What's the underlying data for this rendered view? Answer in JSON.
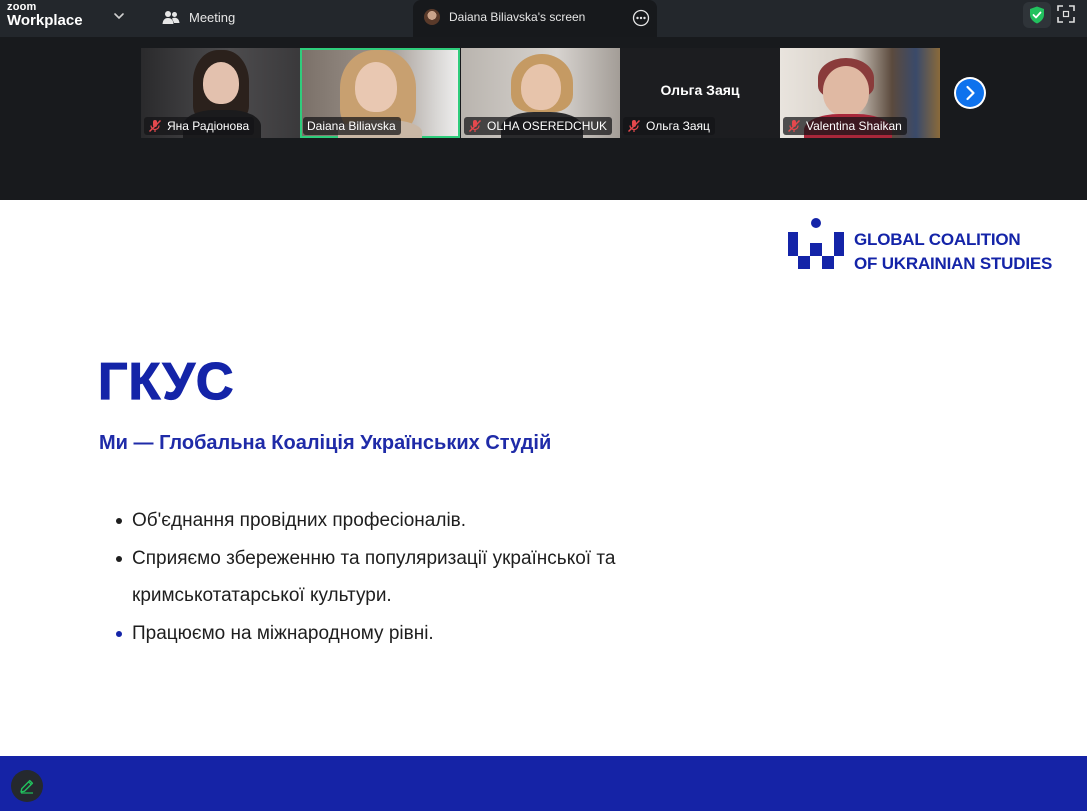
{
  "app": {
    "brand_line1": "zoom",
    "brand_line2": "Workplace",
    "meeting_tab_label": "Meeting",
    "screen_tab_label": "Daiana Biliavska's screen",
    "accent": "#0e72ed",
    "active_speaker_color": "#2fcd7c",
    "secure_color": "#22c15e"
  },
  "participants": [
    {
      "name": "Яна Радіонова",
      "muted": true,
      "video": true,
      "active": false
    },
    {
      "name": "Daiana Biliavska",
      "muted": false,
      "video": true,
      "active": true
    },
    {
      "name": "OLHA OSEREDCHUK",
      "muted": true,
      "video": true,
      "active": false
    },
    {
      "name": "Ольга Заяц",
      "muted": true,
      "video": false,
      "active": false,
      "display_name": "Ольга Заяц"
    },
    {
      "name": "Valentina Shaikan",
      "muted": true,
      "video": true,
      "active": false
    }
  ],
  "slide": {
    "logo_line1": "GLOBAL COALITION",
    "logo_line2": "OF UKRAINIAN STUDIES",
    "title": "ГКУС",
    "subtitle": "Ми — Глобальна Коаліція Українських Студій",
    "bullets": [
      "Об'єднання провідних професіоналів.",
      "Сприяємо збереженню та популяризації української та кримськотатарської культури.",
      "Працюємо на міжнародному рівні."
    ],
    "brand_color": "#1424a8"
  }
}
